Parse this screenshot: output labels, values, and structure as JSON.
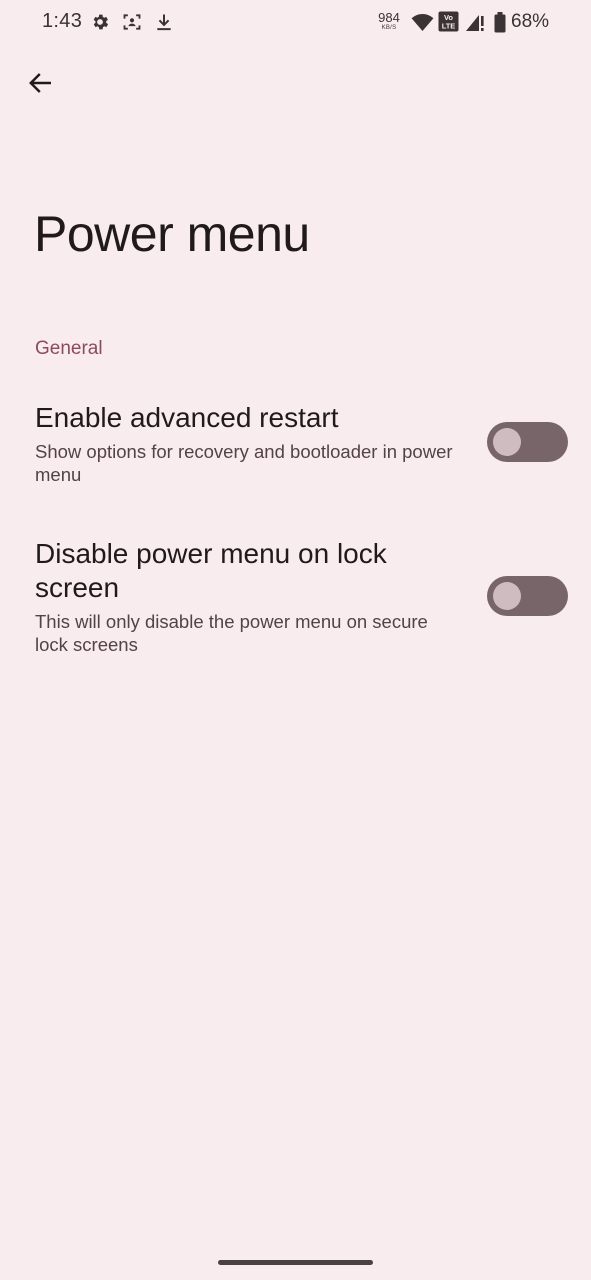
{
  "status_bar": {
    "time": "1:43",
    "left_icons": [
      "gear-icon",
      "face-scan-icon",
      "download-icon"
    ],
    "net_speed_value": "984",
    "net_speed_unit": "KB/S",
    "right_icons": [
      "wifi-icon",
      "volte-icon",
      "signal-icon",
      "battery-icon"
    ],
    "volte_label": "Vo LTE",
    "battery": "68%"
  },
  "header": {
    "back_icon": "arrow-back-icon",
    "title": "Power menu"
  },
  "section": {
    "label": "General"
  },
  "settings": [
    {
      "title": "Enable advanced restart",
      "summary": "Show options for recovery and bootloader in power menu",
      "enabled": false
    },
    {
      "title": "Disable power menu on lock screen",
      "summary": "This will only disable the power menu on secure lock screens",
      "enabled": false
    }
  ],
  "colors": {
    "background": "#f9ecee",
    "accent": "#8b4a62",
    "toggle_track": "#776569",
    "toggle_thumb": "#cfbcc0"
  }
}
